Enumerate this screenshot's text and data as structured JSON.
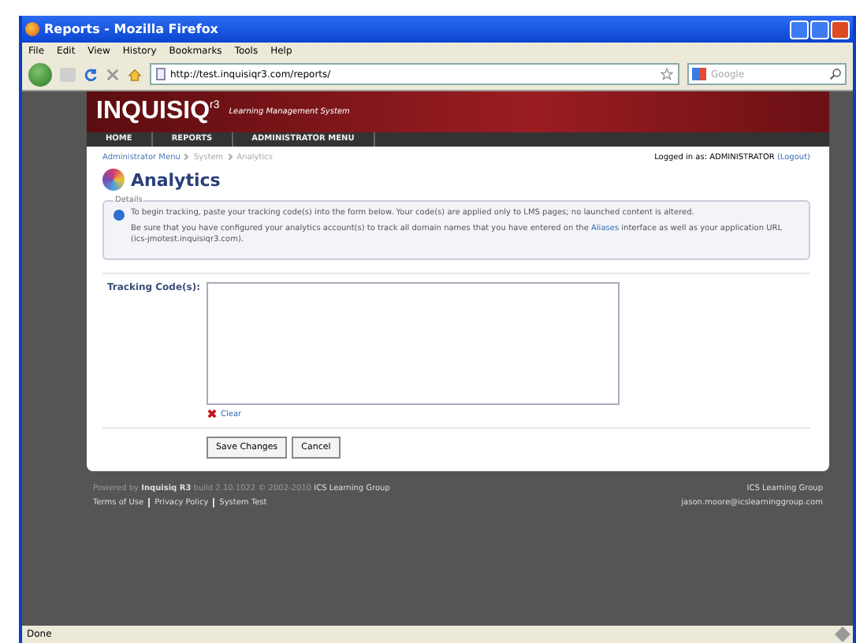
{
  "window": {
    "title": "Reports - Mozilla Firefox"
  },
  "menu": [
    "File",
    "Edit",
    "View",
    "History",
    "Bookmarks",
    "Tools",
    "Help"
  ],
  "toolbar": {
    "url": "http://test.inquisiqr3.com/reports/",
    "search_placeholder": "Google"
  },
  "header": {
    "logo": "INQUISIQ",
    "logo_sup": "r3",
    "tagline": "Learning Management System"
  },
  "nav": [
    {
      "label": "HOME"
    },
    {
      "label": "REPORTS"
    },
    {
      "label": "ADMINISTRATOR MENU"
    }
  ],
  "breadcrumb": [
    "Administrator Menu",
    "System",
    "Analytics"
  ],
  "login": {
    "label": "Logged in as: ADMINISTRATOR",
    "logout": "(Logout)"
  },
  "page_title": "Analytics",
  "details": {
    "legend": "Details",
    "line1": "To begin tracking, paste your tracking code(s) into the form below. Your code(s) are applied only to LMS pages; no launched content is altered.",
    "line2_before": "Be sure that you have configured your analytics account(s) to track all domain names that you have entered on the",
    "line2_link": "Aliases",
    "line2_after": "interface as well as your application URL (ics-jmotest.inquisiqr3.com)."
  },
  "form": {
    "label": "Tracking Code(s):",
    "clear": "Clear"
  },
  "buttons": [
    "Save Changes",
    "Cancel"
  ],
  "footer": {
    "powered": "Powered by",
    "product": "Inquisiq R3",
    "build": "build 2.10.1022  © 2002-2010",
    "company": "ICS Learning Group",
    "links": [
      "Terms of Use",
      "Privacy Policy",
      "System Test"
    ],
    "right_company": "ICS Learning Group",
    "email": "jason.moore@icslearninggroup.com"
  },
  "status_bar": "Done"
}
